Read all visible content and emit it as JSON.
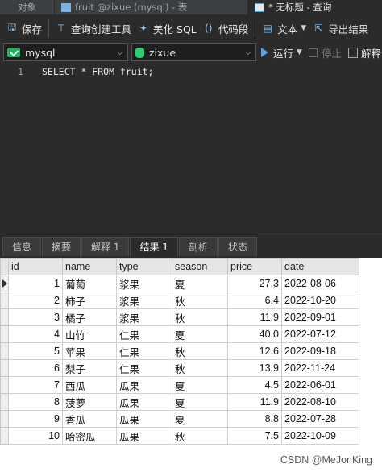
{
  "tabs": [
    {
      "label": "对象"
    },
    {
      "label": "fruit @zixue (mysql) - 表"
    },
    {
      "label": "* 无标题 - 查询"
    }
  ],
  "toolbar": {
    "save": "保存",
    "query_builder": "查询创建工具",
    "beautify": "美化 SQL",
    "snippet": "代码段",
    "text": "文本",
    "export": "导出结果"
  },
  "selectors": {
    "connection": "mysql",
    "database": "zixue",
    "run": "运行",
    "stop": "停止",
    "explain": "解释"
  },
  "editor": {
    "line_number": "1",
    "sql": "SELECT * FROM fruit;"
  },
  "result_tabs": [
    "信息",
    "摘要",
    "解释 1",
    "结果 1",
    "剖析",
    "状态"
  ],
  "active_result_tab": "结果 1",
  "grid": {
    "columns": [
      "id",
      "name",
      "type",
      "season",
      "price",
      "date"
    ],
    "rows": [
      [
        "1",
        "葡萄",
        "浆果",
        "夏",
        "27.3",
        "2022-08-06"
      ],
      [
        "2",
        "柿子",
        "浆果",
        "秋",
        "6.4",
        "2022-10-20"
      ],
      [
        "3",
        "橘子",
        "浆果",
        "秋",
        "11.9",
        "2022-09-01"
      ],
      [
        "4",
        "山竹",
        "仁果",
        "夏",
        "40.0",
        "2022-07-12"
      ],
      [
        "5",
        "苹果",
        "仁果",
        "秋",
        "12.6",
        "2022-09-18"
      ],
      [
        "6",
        "梨子",
        "仁果",
        "秋",
        "13.9",
        "2022-11-24"
      ],
      [
        "7",
        "西瓜",
        "瓜果",
        "夏",
        "4.5",
        "2022-06-01"
      ],
      [
        "8",
        "菠萝",
        "瓜果",
        "夏",
        "11.9",
        "2022-08-10"
      ],
      [
        "9",
        "香瓜",
        "瓜果",
        "夏",
        "8.8",
        "2022-07-28"
      ],
      [
        "10",
        "哈密瓜",
        "瓜果",
        "秋",
        "7.5",
        "2022-10-09"
      ]
    ]
  },
  "watermark": "CSDN @MeJonKing"
}
